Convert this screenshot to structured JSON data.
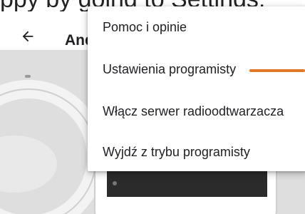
{
  "top_text": "ppy by going to Settings,",
  "appbar": {
    "back_icon": "arrow-left-icon",
    "title": "Android Auto"
  },
  "menu": {
    "items": [
      {
        "label": "Pomoc i opinie"
      },
      {
        "label": "Ustawienia programisty"
      },
      {
        "label": "Włącz serwer radioodtwarzacza"
      },
      {
        "label": "Wyjdź z trybu programisty"
      }
    ]
  },
  "annotation": {
    "color": "#e07a28"
  },
  "illustration": {
    "background": "#dedede"
  }
}
